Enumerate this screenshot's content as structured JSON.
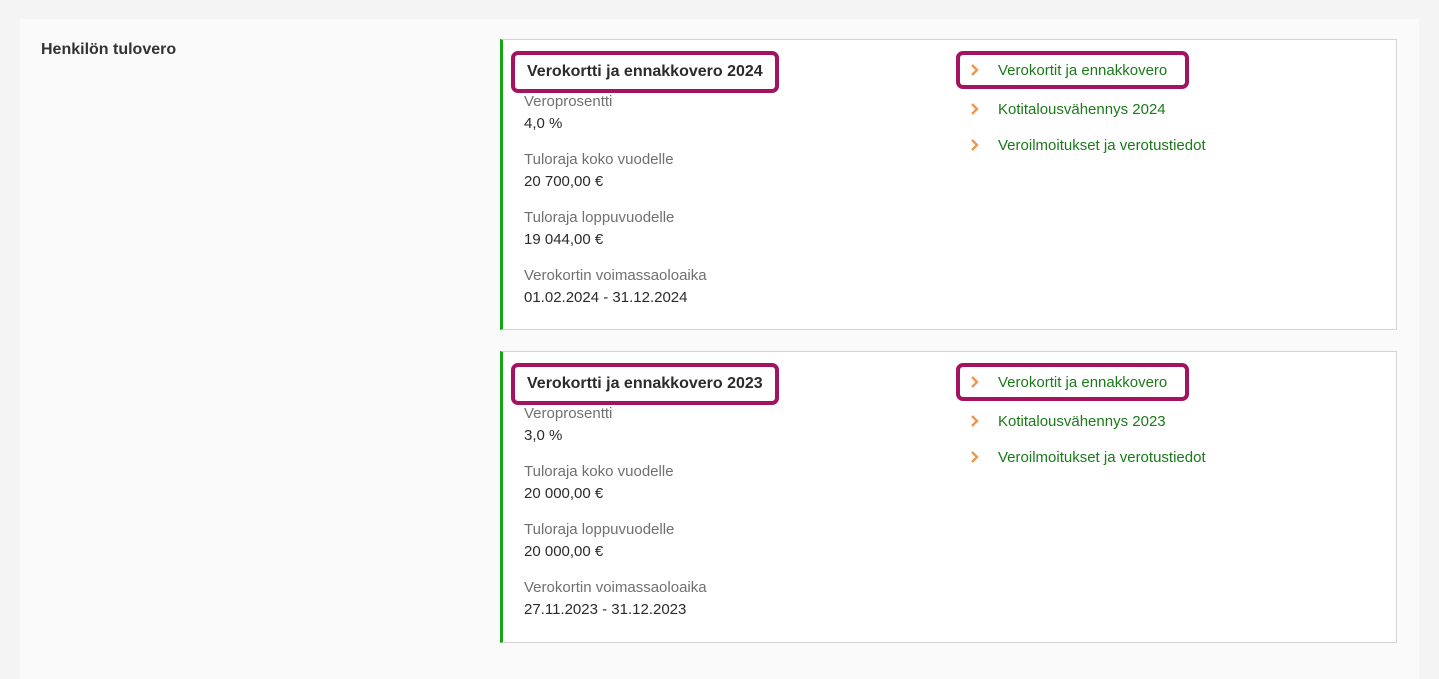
{
  "section": {
    "title": "Henkilön tulovero"
  },
  "cards": [
    {
      "title": "Verokortti ja ennakkovero 2024",
      "fields": [
        {
          "label": "Veroprosentti",
          "value": "4,0 %"
        },
        {
          "label": "Tuloraja koko vuodelle",
          "value": "20 700,00 €"
        },
        {
          "label": "Tuloraja loppuvuodelle",
          "value": "19 044,00 €"
        },
        {
          "label": "Verokortin voimassaoloaika",
          "value": "01.02.2024 - 31.12.2024"
        }
      ],
      "links": [
        {
          "label": "Verokortit ja ennakkovero"
        },
        {
          "label": "Kotitalousvähennys 2024"
        },
        {
          "label": "Veroilmoitukset ja verotustiedot"
        }
      ]
    },
    {
      "title": "Verokortti ja ennakkovero 2023",
      "fields": [
        {
          "label": "Veroprosentti",
          "value": "3,0 %"
        },
        {
          "label": "Tuloraja koko vuodelle",
          "value": "20 000,00 €"
        },
        {
          "label": "Tuloraja loppuvuodelle",
          "value": "20 000,00 €"
        },
        {
          "label": "Verokortin voimassaoloaika",
          "value": "27.11.2023 - 31.12.2023"
        }
      ],
      "links": [
        {
          "label": "Verokortit ja ennakkovero"
        },
        {
          "label": "Kotitalousvähennys 2023"
        },
        {
          "label": "Veroilmoitukset ja verotustiedot"
        }
      ]
    }
  ],
  "colors": {
    "accent_green": "#16a516",
    "link_green": "#1a7a1a",
    "highlight": "#a3135f",
    "chevron_orange": "#f0954a"
  },
  "icons": {
    "link_chevron": "chevron-right-icon"
  }
}
